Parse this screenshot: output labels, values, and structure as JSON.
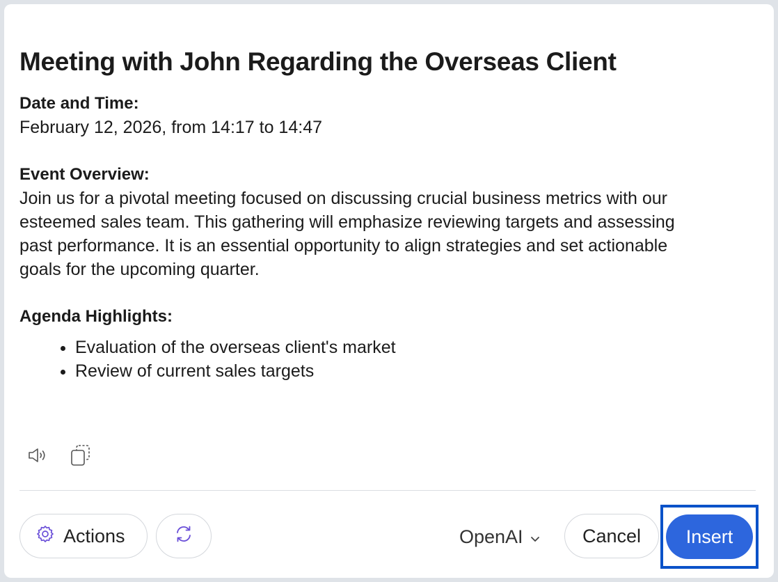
{
  "doc": {
    "title": "Meeting with John Regarding the Overseas Client",
    "date_label": "Date and Time:",
    "date_value": "February 12, 2026, from 14:17 to 14:47",
    "overview_label": "Event Overview:",
    "overview_lines": [
      "Join us for a pivotal meeting focused on discussing crucial business metrics with our",
      "esteemed sales team. This gathering will emphasize reviewing targets and assessing",
      "past performance. It is an essential opportunity to align strategies and set actionable",
      "goals for the upcoming quarter."
    ],
    "agenda_label": "Agenda Highlights:",
    "agenda_items": [
      "Evaluation of the overseas client's market",
      "Review of current sales targets"
    ]
  },
  "tools": {
    "read_aloud_icon": "speaker-icon",
    "copy_icon": "copy-icon"
  },
  "footer": {
    "actions_label": "Actions",
    "actions_icon": "gear-icon",
    "refresh_icon": "refresh-icon",
    "model_label": "OpenAI",
    "model_icon": "chevron-down-icon",
    "cancel_label": "Cancel",
    "insert_label": "Insert"
  },
  "colors": {
    "primary": "#2d66dd",
    "focus_ring": "#0a52c9",
    "icon_purple": "#6a4fd8"
  }
}
